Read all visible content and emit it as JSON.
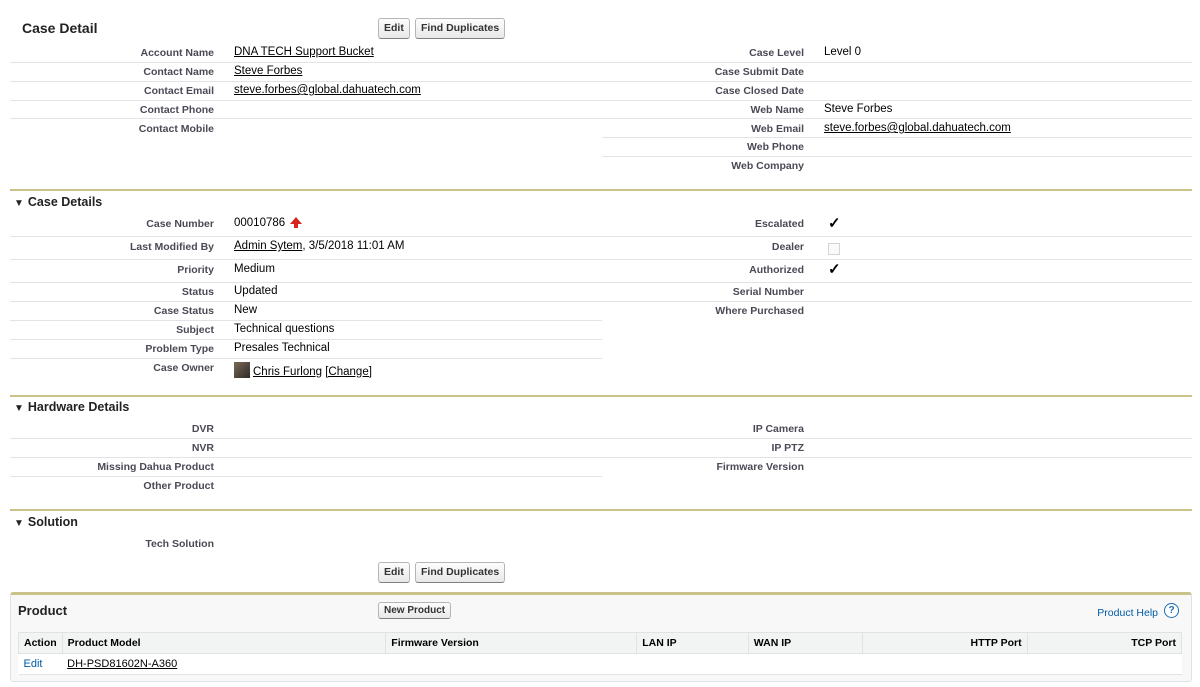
{
  "case_detail": {
    "title": "Case Detail",
    "edit_label": "Edit",
    "find_duplicates_label": "Find Duplicates",
    "left_fields": [
      {
        "label": "Account Name",
        "value": "DNA TECH Support Bucket",
        "link": true
      },
      {
        "label": "Contact Name",
        "value": "Steve Forbes",
        "link": true
      },
      {
        "label": "Contact Email",
        "value": "steve.forbes@global.dahuatech.com",
        "link": true
      },
      {
        "label": "Contact Phone",
        "value": ""
      },
      {
        "label": "Contact Mobile",
        "value": ""
      }
    ],
    "right_fields": [
      {
        "label": "Case Level",
        "value": "Level 0"
      },
      {
        "label": "Case Submit Date",
        "value": ""
      },
      {
        "label": "Case Closed Date",
        "value": ""
      },
      {
        "label": "Web Name",
        "value": "Steve Forbes"
      },
      {
        "label": "Web Email",
        "value": "steve.forbes@global.dahuatech.com",
        "link": true
      },
      {
        "label": "Web Phone",
        "value": ""
      },
      {
        "label": "Web Company",
        "value": ""
      }
    ]
  },
  "case_details": {
    "title": "Case Details",
    "case_number_label": "Case Number",
    "case_number": "00010786",
    "last_modified_label": "Last Modified By",
    "last_modified_user": "Admin Sytem",
    "last_modified_date": ", 3/5/2018 11:01 AM",
    "priority_label": "Priority",
    "priority": "Medium",
    "status_label": "Status",
    "status": "Updated",
    "case_status_label": "Case Status",
    "case_status": "New",
    "subject_label": "Subject",
    "subject": "Technical questions",
    "problem_type_label": "Problem Type",
    "problem_type": "Presales Technical",
    "case_owner_label": "Case Owner",
    "case_owner": "Chris Furlong",
    "change_label": "[Change]",
    "escalated_label": "Escalated",
    "escalated": true,
    "dealer_label": "Dealer",
    "dealer": false,
    "authorized_label": "Authorized",
    "authorized": true,
    "serial_number_label": "Serial Number",
    "where_purchased_label": "Where Purchased",
    "check_glyph": "✓"
  },
  "hardware_details": {
    "title": "Hardware Details",
    "left_labels": [
      "DVR",
      "NVR",
      "Missing Dahua Product",
      "Other Product"
    ],
    "right_labels": [
      "IP Camera",
      "IP PTZ",
      "Firmware Version"
    ]
  },
  "solution": {
    "title": "Solution",
    "tech_solution_label": "Tech Solution"
  },
  "bottom_buttons": {
    "edit_label": "Edit",
    "find_duplicates_label": "Find Duplicates"
  },
  "product": {
    "title": "Product",
    "new_product_label": "New Product",
    "help_label": "Product Help",
    "help_icon_glyph": "?",
    "columns": [
      "Action",
      "Product Model",
      "Firmware Version",
      "LAN IP",
      "WAN IP",
      "HTTP Port",
      "TCP Port"
    ],
    "rows": [
      {
        "action": "Edit",
        "model": "DH-PSD81602N-A360",
        "firmware": "",
        "lan_ip": "",
        "wan_ip": "",
        "http_port": "",
        "tcp_port": ""
      }
    ]
  },
  "icons": {
    "collapse": "triangle-down-icon",
    "escalation": "red-up-arrow-icon",
    "help": "question-circle-icon",
    "avatar": "user-photo-icon"
  },
  "colors": {
    "section_bar": "#c9c38a",
    "label_text": "#4a4a56",
    "link_blue": "#015ba7",
    "escalation_red": "#d7261e"
  }
}
